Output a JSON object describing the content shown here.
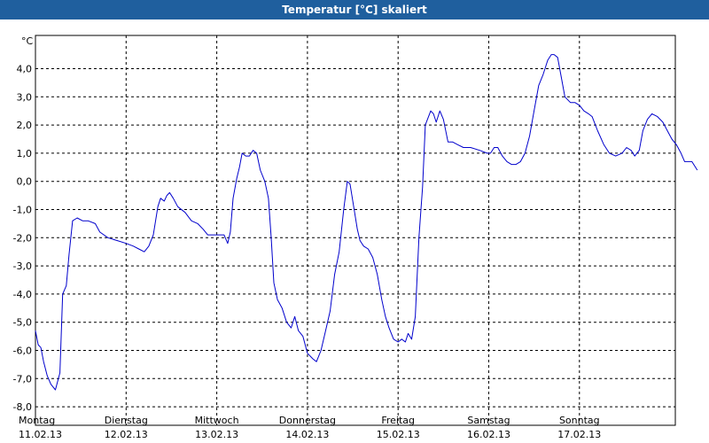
{
  "window": {
    "title": "Temperatur [°C] skaliert"
  },
  "chart_data": {
    "type": "line",
    "title": "Temperatur [°C] skaliert",
    "ylabel": "°C",
    "xlabel": "",
    "ylim": [
      -8,
      5
    ],
    "xlim": [
      0,
      7
    ],
    "grid": true,
    "legend": "none",
    "line_color": "#0000cc",
    "yticks": [
      {
        "value": 4,
        "label": "4,0"
      },
      {
        "value": 3,
        "label": "3,0"
      },
      {
        "value": 2,
        "label": "2,0"
      },
      {
        "value": 1,
        "label": "1,0"
      },
      {
        "value": 0,
        "label": "0,0"
      },
      {
        "value": -1,
        "label": "-1,0"
      },
      {
        "value": -2,
        "label": "-2,0"
      },
      {
        "value": -3,
        "label": "-3,0"
      },
      {
        "value": -4,
        "label": "-4,0"
      },
      {
        "value": -5,
        "label": "-5,0"
      },
      {
        "value": -6,
        "label": "-6,0"
      },
      {
        "value": -7,
        "label": "-7,0"
      },
      {
        "value": -8,
        "label": "-8,0"
      }
    ],
    "xticks": [
      {
        "value": 0,
        "day": "Montag",
        "date": "11.02.13"
      },
      {
        "value": 1,
        "day": "Dienstag",
        "date": "12.02.13"
      },
      {
        "value": 2,
        "day": "Mittwoch",
        "date": "13.02.13"
      },
      {
        "value": 3,
        "day": "Donnerstag",
        "date": "14.02.13"
      },
      {
        "value": 4,
        "day": "Freitag",
        "date": "15.02.13"
      },
      {
        "value": 5,
        "day": "Samstag",
        "date": "16.02.13"
      },
      {
        "value": 6,
        "day": "Sonntag",
        "date": "17.02.13"
      }
    ],
    "series": [
      {
        "points": [
          [
            0.0,
            -5.3
          ],
          [
            0.03,
            -5.8
          ],
          [
            0.06,
            -5.9
          ],
          [
            0.09,
            -6.4
          ],
          [
            0.13,
            -6.9
          ],
          [
            0.17,
            -7.2
          ],
          [
            0.22,
            -7.4
          ],
          [
            0.27,
            -6.8
          ],
          [
            0.3,
            -4.0
          ],
          [
            0.34,
            -3.7
          ],
          [
            0.37,
            -2.6
          ],
          [
            0.41,
            -1.4
          ],
          [
            0.46,
            -1.3
          ],
          [
            0.52,
            -1.4
          ],
          [
            0.58,
            -1.4
          ],
          [
            0.66,
            -1.5
          ],
          [
            0.71,
            -1.8
          ],
          [
            0.8,
            -2.0
          ],
          [
            0.9,
            -2.1
          ],
          [
            1.0,
            -2.2
          ],
          [
            1.08,
            -2.3
          ],
          [
            1.14,
            -2.4
          ],
          [
            1.2,
            -2.5
          ],
          [
            1.25,
            -2.3
          ],
          [
            1.3,
            -1.9
          ],
          [
            1.35,
            -0.9
          ],
          [
            1.38,
            -0.6
          ],
          [
            1.42,
            -0.7
          ],
          [
            1.45,
            -0.5
          ],
          [
            1.48,
            -0.4
          ],
          [
            1.52,
            -0.6
          ],
          [
            1.57,
            -0.9
          ],
          [
            1.65,
            -1.1
          ],
          [
            1.72,
            -1.4
          ],
          [
            1.79,
            -1.5
          ],
          [
            1.85,
            -1.7
          ],
          [
            1.9,
            -1.9
          ],
          [
            2.0,
            -1.9
          ],
          [
            2.08,
            -1.9
          ],
          [
            2.12,
            -2.2
          ],
          [
            2.15,
            -1.8
          ],
          [
            2.18,
            -0.6
          ],
          [
            2.22,
            0.1
          ],
          [
            2.25,
            0.5
          ],
          [
            2.28,
            1.0
          ],
          [
            2.32,
            0.9
          ],
          [
            2.36,
            0.9
          ],
          [
            2.4,
            1.1
          ],
          [
            2.44,
            1.0
          ],
          [
            2.48,
            0.4
          ],
          [
            2.53,
            0.0
          ],
          [
            2.57,
            -0.6
          ],
          [
            2.6,
            -2.0
          ],
          [
            2.63,
            -3.6
          ],
          [
            2.67,
            -4.2
          ],
          [
            2.72,
            -4.5
          ],
          [
            2.77,
            -5.0
          ],
          [
            2.82,
            -5.2
          ],
          [
            2.86,
            -4.8
          ],
          [
            2.9,
            -5.3
          ],
          [
            2.95,
            -5.5
          ],
          [
            3.0,
            -6.1
          ],
          [
            3.06,
            -6.3
          ],
          [
            3.1,
            -6.4
          ],
          [
            3.15,
            -6.0
          ],
          [
            3.2,
            -5.3
          ],
          [
            3.25,
            -4.6
          ],
          [
            3.3,
            -3.3
          ],
          [
            3.35,
            -2.5
          ],
          [
            3.4,
            -1.0
          ],
          [
            3.44,
            0.0
          ],
          [
            3.47,
            -0.1
          ],
          [
            3.51,
            -0.9
          ],
          [
            3.55,
            -1.7
          ],
          [
            3.58,
            -2.1
          ],
          [
            3.62,
            -2.3
          ],
          [
            3.67,
            -2.4
          ],
          [
            3.72,
            -2.7
          ],
          [
            3.77,
            -3.3
          ],
          [
            3.82,
            -4.2
          ],
          [
            3.86,
            -4.8
          ],
          [
            3.9,
            -5.2
          ],
          [
            3.95,
            -5.6
          ],
          [
            4.0,
            -5.7
          ],
          [
            4.04,
            -5.6
          ],
          [
            4.08,
            -5.7
          ],
          [
            4.11,
            -5.4
          ],
          [
            4.15,
            -5.6
          ],
          [
            4.19,
            -4.8
          ],
          [
            4.23,
            -2.0
          ],
          [
            4.27,
            -0.2
          ],
          [
            4.3,
            2.0
          ],
          [
            4.36,
            2.5
          ],
          [
            4.39,
            2.4
          ],
          [
            4.42,
            2.1
          ],
          [
            4.46,
            2.5
          ],
          [
            4.5,
            2.2
          ],
          [
            4.55,
            1.4
          ],
          [
            4.6,
            1.4
          ],
          [
            4.66,
            1.3
          ],
          [
            4.72,
            1.2
          ],
          [
            4.8,
            1.2
          ],
          [
            4.9,
            1.1
          ],
          [
            4.98,
            1.0
          ],
          [
            5.02,
            1.0
          ],
          [
            5.06,
            1.2
          ],
          [
            5.1,
            1.2
          ],
          [
            5.15,
            0.9
          ],
          [
            5.2,
            0.7
          ],
          [
            5.25,
            0.6
          ],
          [
            5.3,
            0.6
          ],
          [
            5.35,
            0.7
          ],
          [
            5.4,
            1.0
          ],
          [
            5.45,
            1.6
          ],
          [
            5.5,
            2.5
          ],
          [
            5.55,
            3.4
          ],
          [
            5.6,
            3.8
          ],
          [
            5.65,
            4.3
          ],
          [
            5.69,
            4.5
          ],
          [
            5.72,
            4.5
          ],
          [
            5.76,
            4.4
          ],
          [
            5.8,
            3.7
          ],
          [
            5.84,
            3.0
          ],
          [
            5.9,
            2.8
          ],
          [
            5.95,
            2.8
          ],
          [
            6.0,
            2.7
          ],
          [
            6.05,
            2.5
          ],
          [
            6.1,
            2.4
          ],
          [
            6.14,
            2.3
          ],
          [
            6.2,
            1.8
          ],
          [
            6.27,
            1.3
          ],
          [
            6.33,
            1.0
          ],
          [
            6.4,
            0.9
          ],
          [
            6.47,
            1.0
          ],
          [
            6.52,
            1.2
          ],
          [
            6.57,
            1.1
          ],
          [
            6.61,
            0.9
          ],
          [
            6.66,
            1.1
          ],
          [
            6.7,
            1.8
          ],
          [
            6.75,
            2.2
          ],
          [
            6.8,
            2.4
          ],
          [
            6.86,
            2.3
          ],
          [
            6.92,
            2.1
          ],
          [
            6.97,
            1.8
          ],
          [
            7.02,
            1.5
          ],
          [
            7.07,
            1.3
          ],
          [
            7.12,
            1.0
          ],
          [
            7.16,
            0.7
          ],
          [
            7.2,
            0.7
          ],
          [
            7.24,
            0.7
          ],
          [
            7.3,
            0.4
          ]
        ]
      }
    ]
  }
}
